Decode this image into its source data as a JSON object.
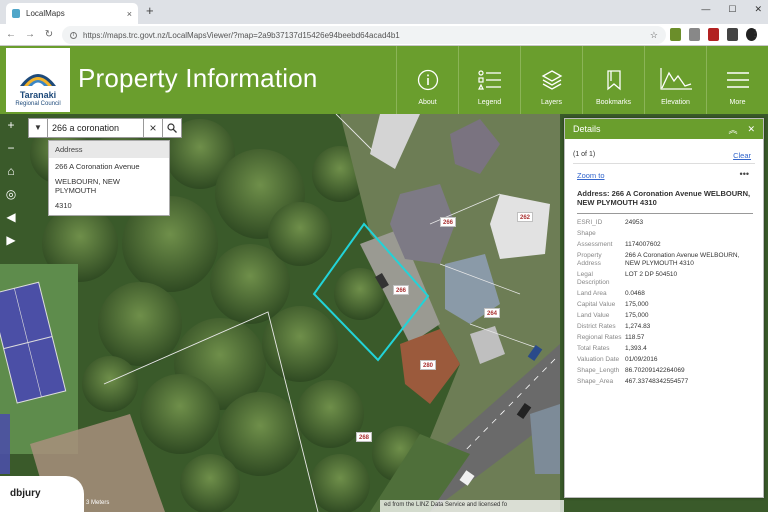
{
  "browser": {
    "tab_title": "LocalMaps",
    "tab_close": "×",
    "new_tab": "+",
    "url": "https://maps.trc.govt.nz/LocalMapsViewer/?map=2a9b37137d15426e94beebd64acad4b1",
    "window_controls": [
      "—",
      "☐",
      "✕"
    ]
  },
  "header": {
    "logo_name": "Taranaki",
    "logo_sub": "Regional Council",
    "title": "Property Information",
    "tools": [
      {
        "label": "About",
        "icon": "info-icon"
      },
      {
        "label": "Legend",
        "icon": "legend-icon"
      },
      {
        "label": "Layers",
        "icon": "layers-icon"
      },
      {
        "label": "Bookmarks",
        "icon": "bookmark-icon"
      },
      {
        "label": "Elevation",
        "icon": "elevation-icon"
      },
      {
        "label": "More",
        "icon": "menu-icon"
      }
    ]
  },
  "search": {
    "value": "266 a coronation",
    "clear": "×"
  },
  "suggestions": {
    "header": "Address",
    "line1": "266 A Coronation Avenue",
    "line2": "WELBOURN, NEW PLYMOUTH",
    "line3": "4310"
  },
  "map_labels": {
    "l1": "266",
    "l2": "266",
    "l3": "264",
    "l4": "262",
    "l5": "280",
    "l6": "268"
  },
  "details": {
    "title": "Details",
    "count": "(1 of 1)",
    "clear": "Clear",
    "zoom_to": "Zoom to",
    "more": "•••",
    "address": "Address: 266 A Coronation Avenue WELBOURN, NEW PLYMOUTH 4310",
    "attributes": [
      {
        "key": "ESRI_ID",
        "value": "24953"
      },
      {
        "key": "Shape",
        "value": ""
      },
      {
        "key": "Assessment",
        "value": "1174007602"
      },
      {
        "key": "Property Address",
        "value": "266 A Coronation Avenue WELBOURN, NEW PLYMOUTH 4310"
      },
      {
        "key": "Legal Description",
        "value": "LOT 2 DP 504510"
      },
      {
        "key": "Land Area",
        "value": "0.0468"
      },
      {
        "key": "Capital Value",
        "value": "175,000"
      },
      {
        "key": "Land Value",
        "value": "175,000"
      },
      {
        "key": "District Rates",
        "value": "1,274.83"
      },
      {
        "key": "Regional Rates",
        "value": "118.57"
      },
      {
        "key": "Total Rates",
        "value": "1,393.4"
      },
      {
        "key": "Valuation Date",
        "value": "01/09/2016"
      },
      {
        "key": "Shape_Length",
        "value": "86.70209142264069"
      },
      {
        "key": "Shape_Area",
        "value": "467.33748342554577"
      }
    ]
  },
  "footer": {
    "user": "dbjury",
    "scale": "3 Meters",
    "attribution": "ed from the LINZ Data Service and licensed fo"
  },
  "colors": {
    "brand_green": "#6a9e2d",
    "parcel_highlight": "#22d3d8",
    "link_blue": "#3366cc"
  }
}
